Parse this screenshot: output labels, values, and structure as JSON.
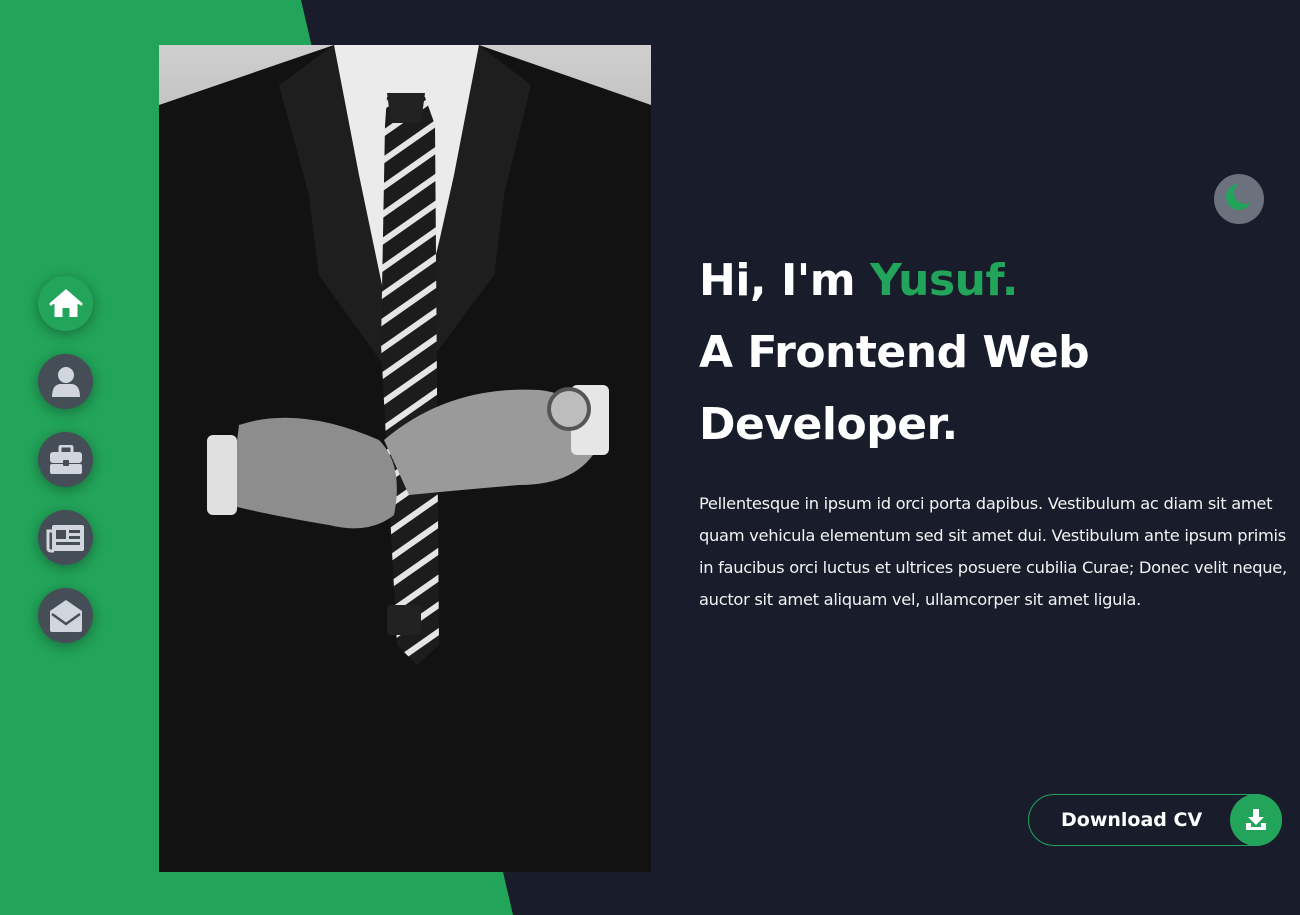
{
  "nav": {
    "items": [
      {
        "name": "home",
        "icon": "home-icon",
        "active": true
      },
      {
        "name": "about",
        "icon": "user-icon",
        "active": false
      },
      {
        "name": "portfolio",
        "icon": "briefcase-icon",
        "active": false
      },
      {
        "name": "blog",
        "icon": "newspaper-icon",
        "active": false
      },
      {
        "name": "contact",
        "icon": "envelope-open-icon",
        "active": false
      }
    ]
  },
  "hero": {
    "greeting": "Hi, I'm ",
    "name": "Yusuf.",
    "line2": "A Frontend Web",
    "line3": "Developer.",
    "description": "Pellentesque in ipsum id orci porta dapibus. Vestibulum ac diam sit amet quam vehicula elementum sed sit amet dui. Vestibulum ante ipsum primis in faucibus orci luctus et ultrices posuere cubilia Curae; Donec velit neque, auctor sit amet aliquam vel, ullamcorper sit amet ligula."
  },
  "theme_toggle": {
    "icon": "moon-icon"
  },
  "download": {
    "label": "Download CV",
    "icon": "download-icon"
  },
  "colors": {
    "accent": "#22a55a",
    "background": "#191d2b",
    "nav_inactive": "#454e56"
  }
}
